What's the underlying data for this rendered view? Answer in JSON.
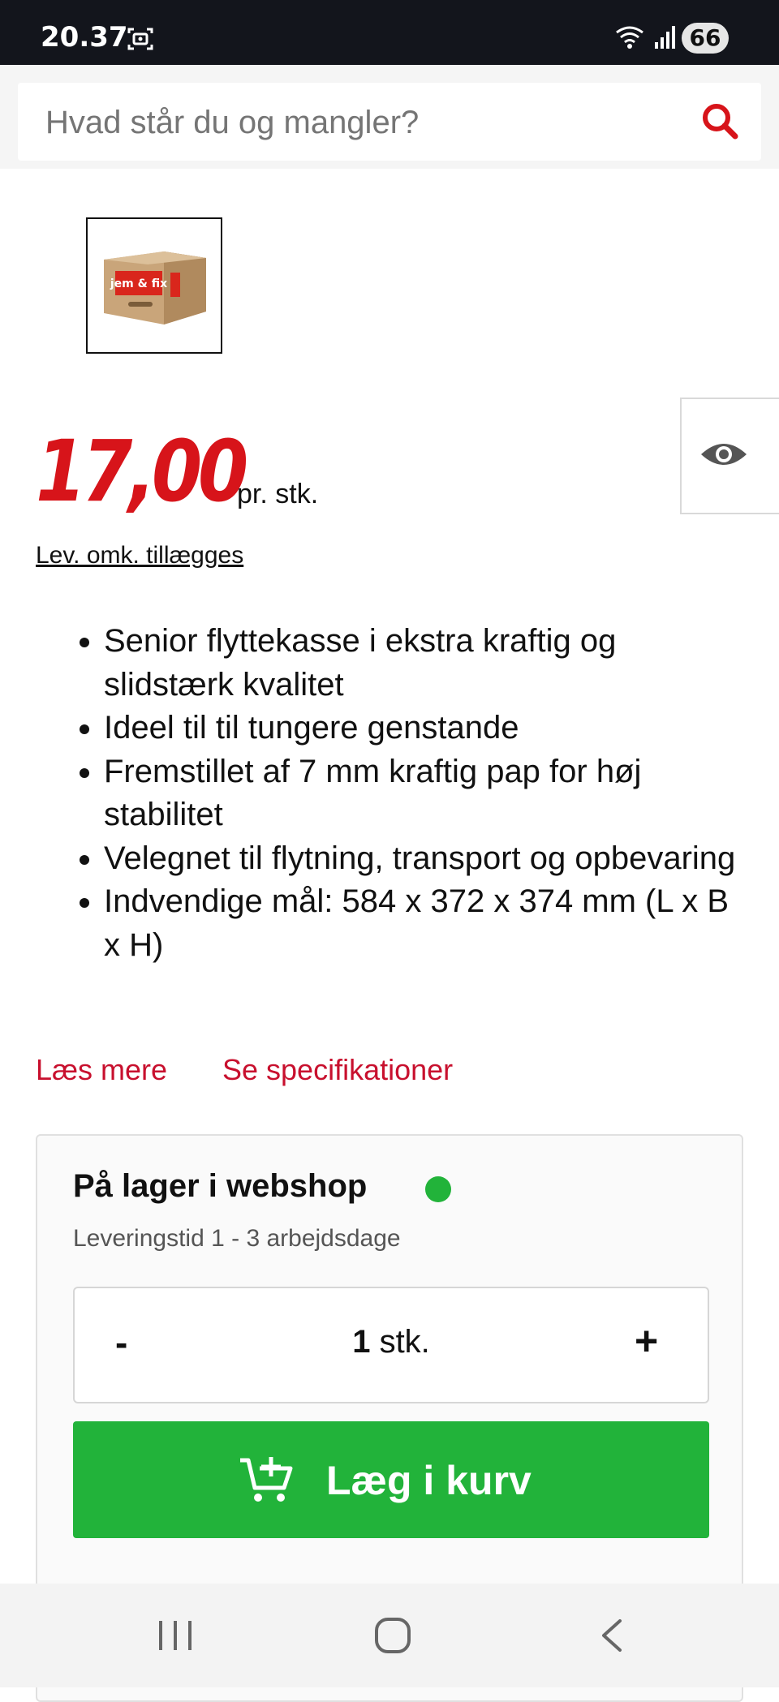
{
  "status_bar": {
    "time": "20.37",
    "battery": "66",
    "icons": [
      "screen-record-icon",
      "wifi-icon",
      "signal-icon",
      "battery-icon"
    ]
  },
  "search": {
    "placeholder": "Hvad står du og mangler?",
    "icon": "search-icon"
  },
  "product": {
    "thumbnail_brand": "jem & fix",
    "price": "17,00",
    "price_unit": "pr. stk.",
    "shipping_note": "Lev. omk. tillægges",
    "bullets": [
      "Senior flyttekasse i ekstra kraftig og slidstærk kvalitet",
      "Ideel til  til tungere genstande",
      "Fremstillet af 7 mm kraftig pap for høj stabilitet",
      "Velegnet til flytning, transport og opbevaring",
      "Indvendige mål: 584 x 372 x 374 mm (L x B x H)"
    ],
    "read_more": "Læs mere",
    "see_specs": "Se specifikationer"
  },
  "stock": {
    "title": "På lager i webshop",
    "status_color": "#22b33a",
    "delivery": "Leveringstid 1 - 3 arbejdsdage"
  },
  "quantity": {
    "minus": "-",
    "value": "1",
    "unit": "stk.",
    "plus": "+"
  },
  "cart": {
    "label": "Læg i kurv",
    "color": "#22b33a"
  },
  "colors": {
    "accent_red": "#d7141a",
    "link_red": "#c8102e"
  }
}
